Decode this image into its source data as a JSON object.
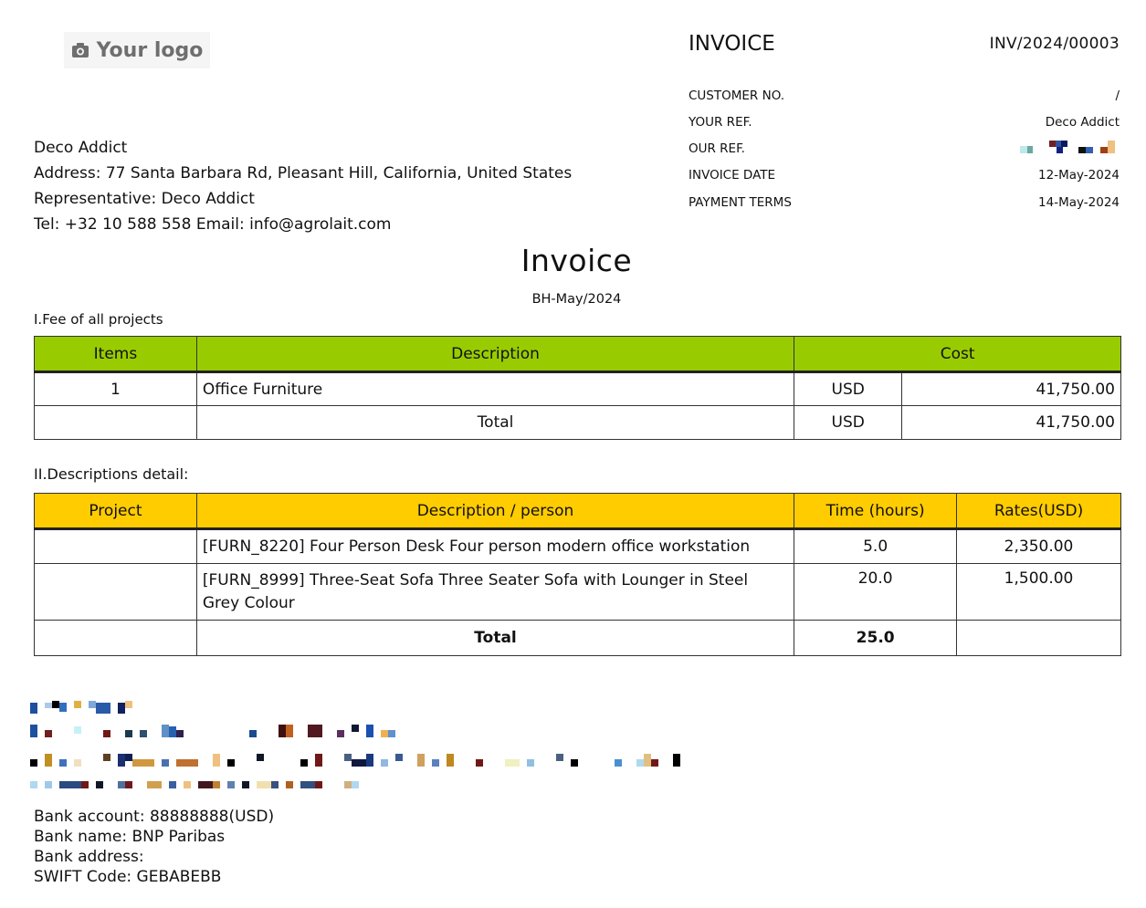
{
  "logo": {
    "text": "Your logo",
    "icon": "camera-icon"
  },
  "header": {
    "title": "INVOICE",
    "number": "INV/2024/00003"
  },
  "meta": [
    {
      "label": "CUSTOMER NO.",
      "value": "/"
    },
    {
      "label": "YOUR REF.",
      "value": "Deco Addict"
    },
    {
      "label": "OUR REF.",
      "value": ""
    },
    {
      "label": "INVOICE DATE",
      "value": "12-May-2024"
    },
    {
      "label": "PAYMENT TERMS",
      "value": "14-May-2024"
    }
  ],
  "customer": {
    "name": "Deco Addict",
    "address": "Address: 77 Santa Barbara Rd, Pleasant Hill, California, United States",
    "representative": "Representative: Deco Addict",
    "contact": "Tel: +32 10 588 558 Email: info@agrolait.com"
  },
  "doc": {
    "title": "Invoice",
    "subtitle": "BH-May/2024"
  },
  "section1": {
    "heading": "I.Fee of all projects",
    "columns": [
      "Items",
      "Description",
      "Cost"
    ],
    "rows": [
      {
        "item": "1",
        "description": "Office Furniture",
        "currency": "USD",
        "amount": "41,750.00"
      }
    ],
    "total": {
      "label": "Total",
      "currency": "USD",
      "amount": "41,750.00"
    }
  },
  "section2": {
    "heading": "II.Descriptions detail:",
    "columns": [
      "Project",
      "Description / person",
      "Time (hours)",
      "Rates(USD)"
    ],
    "rows": [
      {
        "project": "",
        "description": "[FURN_8220] Four Person Desk Four person modern office workstation",
        "time": "5.0",
        "rate": "2,350.00"
      },
      {
        "project": "",
        "description": "[FURN_8999] Three-Seat Sofa Three Seater Sofa with Lounger in Steel Grey Colour",
        "time": "20.0",
        "rate": "1,500.00"
      }
    ],
    "total": {
      "label": "Total",
      "time": "25.0"
    }
  },
  "bank": {
    "account": "Bank account: 88888888(USD)",
    "name": "Bank name: BNP Paribas",
    "address": "Bank address:",
    "swift": "SWIFT Code: GEBABEBB"
  },
  "colors": {
    "fee_header": "#99cc00",
    "detail_header": "#ffcc00"
  }
}
